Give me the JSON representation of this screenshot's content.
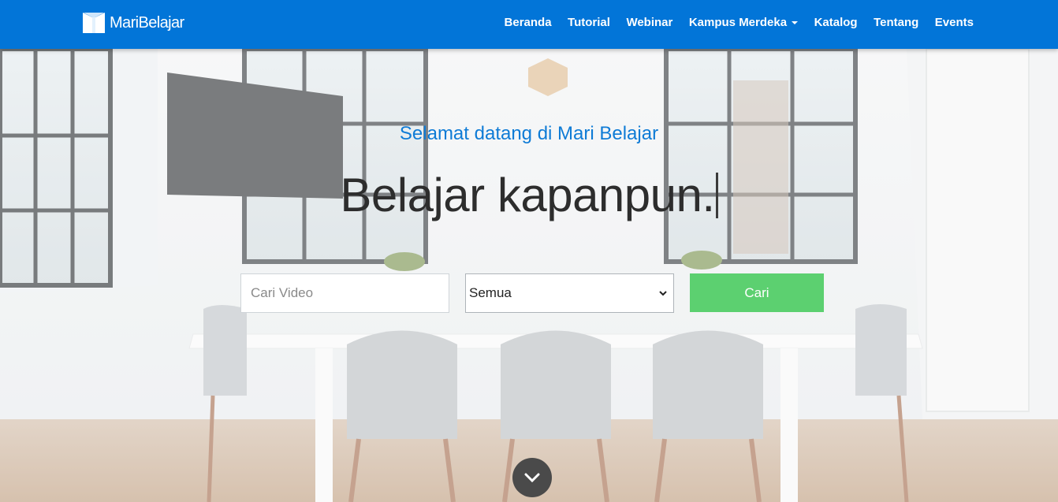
{
  "brand": {
    "name": "MariBelajar",
    "icon": "maribelajar-logo-icon"
  },
  "nav": {
    "items": [
      {
        "label": "Beranda"
      },
      {
        "label": "Tutorial"
      },
      {
        "label": "Webinar"
      },
      {
        "label": "Kampus Merdeka",
        "dropdown": true
      },
      {
        "label": "Katalog"
      },
      {
        "label": "Tentang"
      },
      {
        "label": "Events"
      }
    ]
  },
  "hero": {
    "welcome": "Selamat datang di Mari Belajar",
    "headline": "Belajar kapanpun."
  },
  "search": {
    "placeholder": "Cari Video",
    "value": "",
    "category_selected": "Semua",
    "button_label": "Cari"
  },
  "scroll": {
    "icon": "chevron-down-icon"
  },
  "colors": {
    "navbar": "#0275d8",
    "welcome_text": "#0e7bd6",
    "search_button": "#5cd070",
    "scroll_button": "#4a4a4a"
  }
}
